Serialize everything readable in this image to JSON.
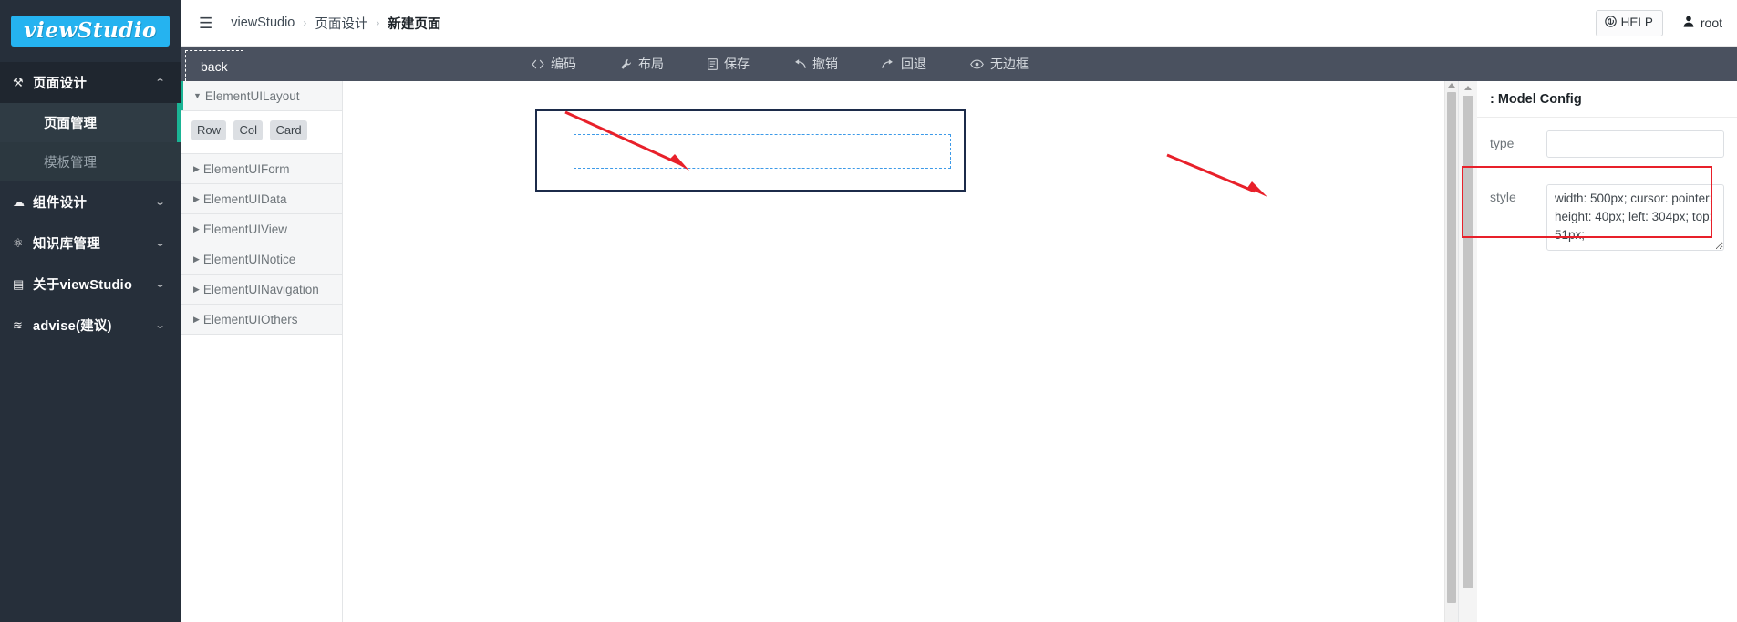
{
  "sidebar": {
    "logo": "viewStudio",
    "items": [
      {
        "label": "页面设计",
        "icon": "wrench-icon",
        "icon_glyph": "⚒",
        "chevron": "⌃",
        "expanded": true,
        "children": [
          {
            "label": "页面管理",
            "active": true
          },
          {
            "label": "模板管理",
            "active": false
          }
        ]
      },
      {
        "label": "组件设计",
        "icon": "cloud-icon",
        "icon_glyph": "☁",
        "chevron": "⌄",
        "expanded": false
      },
      {
        "label": "知识库管理",
        "icon": "flask-icon",
        "icon_glyph": "⚛",
        "chevron": "⌄",
        "expanded": false
      },
      {
        "label": "关于viewStudio",
        "icon": "book-icon",
        "icon_glyph": "▤",
        "chevron": "⌄",
        "expanded": false
      },
      {
        "label": "advise(建议)",
        "icon": "rss-icon",
        "icon_glyph": "≋",
        "chevron": "⌄",
        "expanded": false
      }
    ]
  },
  "topbar": {
    "hamburger_icon": "hamburger-icon",
    "hamburger_glyph": "☰",
    "breadcrumbs": [
      {
        "label": "viewStudio",
        "current": false
      },
      {
        "label": "页面设计",
        "current": false
      },
      {
        "label": "新建页面",
        "current": true
      }
    ],
    "separator": "›",
    "help": {
      "label": "HELP",
      "icon": "github-icon"
    },
    "user": {
      "label": "root",
      "icon": "user-icon"
    }
  },
  "toolbar": {
    "back_tab": "back",
    "actions": [
      {
        "label": "编码",
        "icon": "code-icon",
        "glyph": "<>"
      },
      {
        "label": "布局",
        "icon": "wrench-icon",
        "glyph": "⚒"
      },
      {
        "label": "保存",
        "icon": "save-icon",
        "glyph": "▤"
      },
      {
        "label": "撤销",
        "icon": "undo-icon",
        "glyph": "↰"
      },
      {
        "label": "回退",
        "icon": "redo-icon",
        "glyph": "↗"
      },
      {
        "label": "无边框",
        "icon": "eye-icon",
        "glyph": "◉"
      }
    ]
  },
  "components_panel": {
    "groups": [
      {
        "label": "ElementUILayout",
        "open": true,
        "marker": "▼",
        "chips": [
          "Row",
          "Col",
          "Card"
        ]
      },
      {
        "label": "ElementUIForm",
        "open": false,
        "marker": "▶"
      },
      {
        "label": "ElementUIData",
        "open": false,
        "marker": "▶"
      },
      {
        "label": "ElementUIView",
        "open": false,
        "marker": "▶"
      },
      {
        "label": "ElementUINotice",
        "open": false,
        "marker": "▶"
      },
      {
        "label": "ElementUINavigation",
        "open": false,
        "marker": "▶"
      },
      {
        "label": "ElementUIOthers",
        "open": false,
        "marker": "▶"
      }
    ]
  },
  "canvas": {
    "selected_widget": "row-container",
    "inner_placeholder": "col-dropzone"
  },
  "config_panel": {
    "title": ": Model Config",
    "fields": [
      {
        "name": "type",
        "label": "type",
        "kind": "input",
        "value": "",
        "placeholder": ""
      },
      {
        "name": "style",
        "label": "style",
        "kind": "textarea",
        "value": "width: 500px; cursor: pointer; height: 40px; left: 304px; top: 51px;",
        "placeholder": "",
        "highlighted": true
      }
    ]
  },
  "colors": {
    "sidebar_bg": "#262f3a",
    "sidebar_sub_bg": "#2c3840",
    "accent_teal": "#1ab394",
    "logo_blue": "#25b3f0",
    "toolbar_bg": "#4a515f",
    "widget_border": "#1c2b4a",
    "dropzone_border": "#3d9ae8",
    "annotation_red": "#e8202a"
  }
}
